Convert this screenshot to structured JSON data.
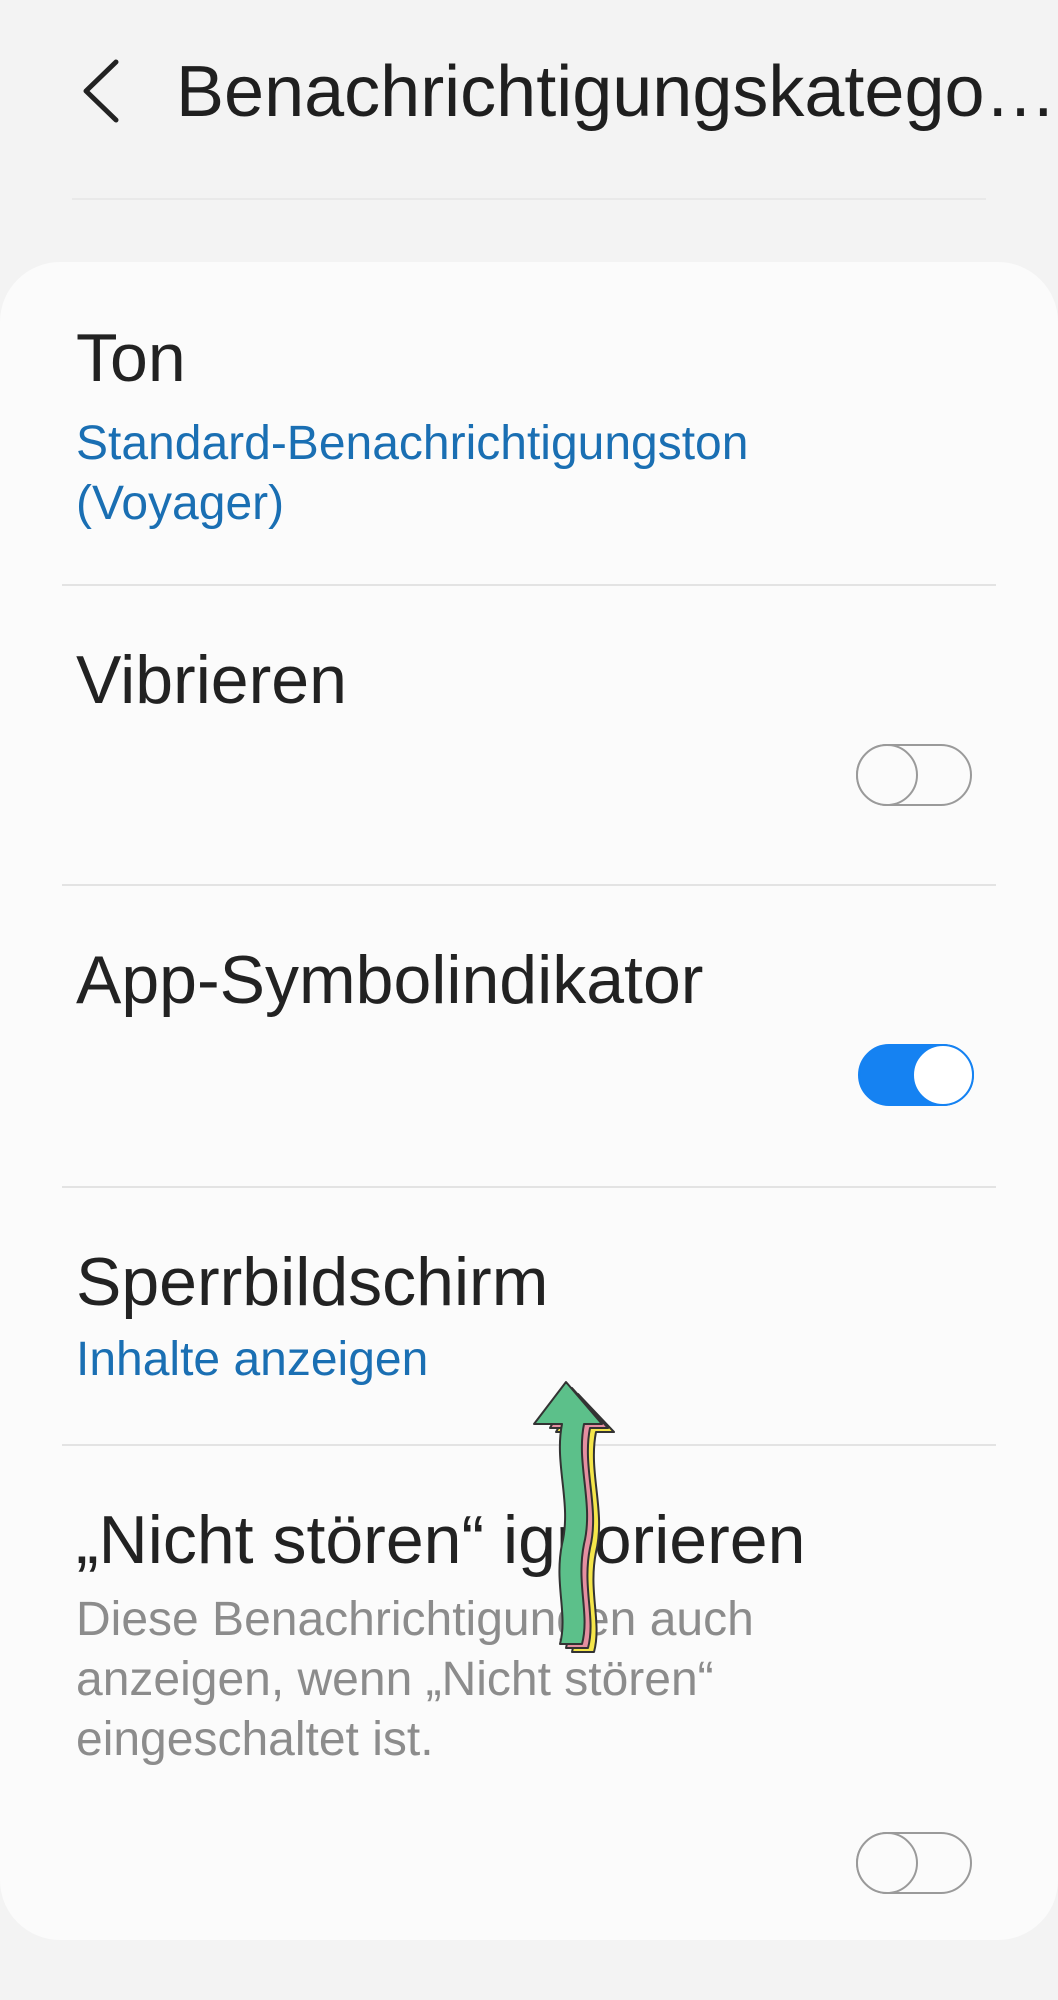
{
  "header": {
    "title": "Benachrichtigungskatego…"
  },
  "settings": {
    "ton": {
      "title": "Ton",
      "value": "Standard-Benachrichtigungston (Voyager)"
    },
    "vibrieren": {
      "title": "Vibrieren",
      "enabled": false
    },
    "app_symbol": {
      "title": "App-Symbolindikator",
      "enabled": true
    },
    "sperrbildschirm": {
      "title": "Sperrbildschirm",
      "value": "Inhalte anzeigen"
    },
    "nicht_stoeren": {
      "title": "„Nicht stören“ ignorieren",
      "description": "Diese Benachrichtigungen auch anzeigen, wenn „Nicht stören“ eingeschaltet ist.",
      "enabled": false
    }
  },
  "colors": {
    "accent": "#1582f2",
    "link": "#1a6fb3",
    "background": "#f3f3f3",
    "card": "#fbfbfb"
  },
  "icons": {
    "back": "chevron-left-icon",
    "gesture": "swipe-up-arrow-icon"
  }
}
